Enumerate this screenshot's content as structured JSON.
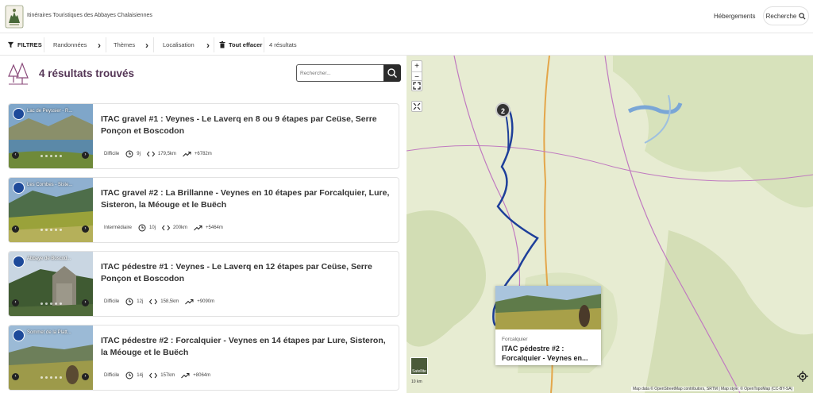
{
  "header": {
    "site_title": "Itinéraires Touristiques des Abbayes Chalaisiennes",
    "hebergements": "Hébergements",
    "search_label": "Recherche"
  },
  "filters": {
    "filtres": "FILTRES",
    "randonnees": "Randonnées",
    "themes": "Thèmes",
    "localisation": "Localisation",
    "tout_effacer": "Tout effacer",
    "count": "4 résultats"
  },
  "results": {
    "title": "4 résultats trouvés",
    "search_placeholder": "Rechercher..."
  },
  "cards": [
    {
      "thumb_label": "Lac de Peyssier - R...",
      "title": "ITAC gravel #1 : Veynes - Le Laverq en 8 ou 9 étapes par Ceüse, Serre Ponçon et Boscodon",
      "difficulty": "Difficile",
      "duration": "9j",
      "distance": "179,5km",
      "elevation": "+6782m"
    },
    {
      "thumb_label": "Les Combes - Siste...",
      "title": "ITAC gravel #2 : La Brillanne - Veynes en 10 étapes par Forcalquier, Lure, Sisteron, la Méouge et le Buëch",
      "difficulty": "Intermédiaire",
      "duration": "10j",
      "distance": "200km",
      "elevation": "+5464m"
    },
    {
      "thumb_label": "Abbaye de Boscod...",
      "title": "ITAC pédestre #1 : Veynes - Le Laverq en 12 étapes par Ceüse, Serre Ponçon et Boscodon",
      "difficulty": "Difficile",
      "duration": "12j",
      "distance": "158,5km",
      "elevation": "+9090m"
    },
    {
      "thumb_label": "Sommet de la Platt...",
      "title": "ITAC pédestre #2 : Forcalquier - Veynes en 14 étapes par Lure, Sisteron, la Méouge et le Buëch",
      "difficulty": "Difficile",
      "duration": "14j",
      "distance": "157km",
      "elevation": "+8064m"
    }
  ],
  "map": {
    "cluster_count": "2",
    "popup_location": "Forcalquier",
    "popup_title": "ITAC pédestre #2 : Forcalquier - Veynes en...",
    "satellite_label": "Satellite",
    "scale_label": "10 km",
    "attribution": "Map data © OpenStreetMap contributors, SRTM | Map style: © OpenTopoMap (CC-BY-SA)",
    "zoom_in": "+",
    "zoom_out": "−"
  },
  "colors": {
    "accent": "#553656",
    "route": "#1e3f9a",
    "badge": "#1e4a9a"
  }
}
